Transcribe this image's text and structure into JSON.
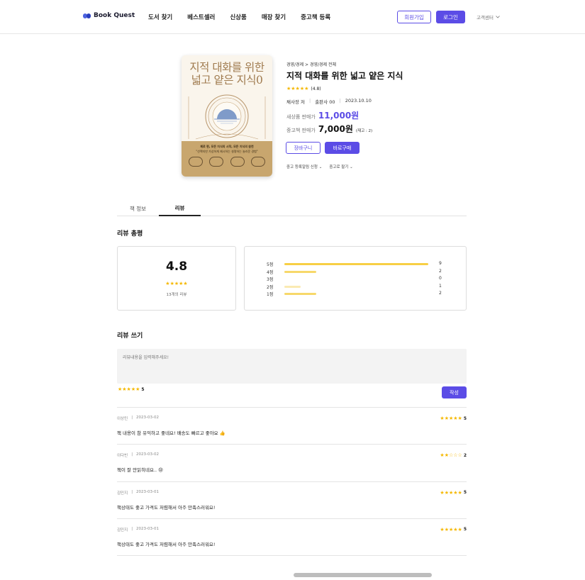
{
  "header": {
    "logo_text": "Book Quest",
    "nav": [
      "도서 찾기",
      "베스트셀러",
      "신상품",
      "매장 찾기",
      "중고책 등록"
    ],
    "join_label": "회원가입",
    "login_label": "로그인",
    "cs_label": "고객센터"
  },
  "cover": {
    "title": "지적 대화를 위한 넓고 얕은 지식0",
    "sub1": "제로 편, 모든 지식의 시작, 모든 지식의 원천",
    "sub2": "\"선택지만 가상하게 제시하는 설명하는 놀라운 경험\""
  },
  "product": {
    "breadcrumb": "경영/경제 > 경영/경제 전체",
    "title": "지적 대화를 위한 넓고 얕은 지식",
    "rating_text": "(4.8)",
    "author": "채사장 저",
    "publisher": "출판사 00",
    "date": "2023.10.10",
    "new_price_label": "새상품 판매가",
    "new_price": "11,000원",
    "used_price_label": "중고책 판매가",
    "used_price": "7,000원",
    "stock": "(재고 : 2)",
    "cart_label": "장바구니",
    "buy_label": "바로구매",
    "link_alert": "중고 등록알림 신청",
    "link_sell": "중고로 팔기"
  },
  "tabs": [
    "책 정보",
    "리뷰"
  ],
  "review_summary": {
    "heading": "리뷰 총평",
    "average": "4.8",
    "count_text": "13개의 리뷰",
    "distribution": [
      {
        "label": "5점",
        "count": 9,
        "color": "#f7cf45"
      },
      {
        "label": "4점",
        "count": 2,
        "color": "#f7d86a"
      },
      {
        "label": "3점",
        "count": 0,
        "color": "#f7d86a"
      },
      {
        "label": "2점",
        "count": 1,
        "color": "#faeab3"
      },
      {
        "label": "1점",
        "count": 2,
        "color": "#f7d86a"
      }
    ],
    "max_count": 9
  },
  "write": {
    "heading": "리뷰 쓰기",
    "placeholder": "리뷰내용을 입력해주세요!",
    "stars": "5",
    "submit_label": "작성"
  },
  "reviews": [
    {
      "name": "이상민",
      "date": "2023-03-02",
      "rating": "5",
      "stars": "★★★★★",
      "text": "책 내용이 참 유익하고 좋네요! 배송도 빠르고 좋아요 👍"
    },
    {
      "name": "이다빈",
      "date": "2023-03-02",
      "rating": "2",
      "stars": "★★☆☆☆",
      "text": "책이 잘 안읽히네요.. 😢"
    },
    {
      "name": "김민지",
      "date": "2023-03-01",
      "rating": "5",
      "stars": "★★★★★",
      "text": "책상태도 좋고 가격도 저렴해서 아주 만족스러워요!"
    },
    {
      "name": "김민지",
      "date": "2023-03-01",
      "rating": "5",
      "stars": "★★★★★",
      "text": "책상태도 좋고 가격도 저렴해서 아주 만족스러워요!"
    }
  ]
}
